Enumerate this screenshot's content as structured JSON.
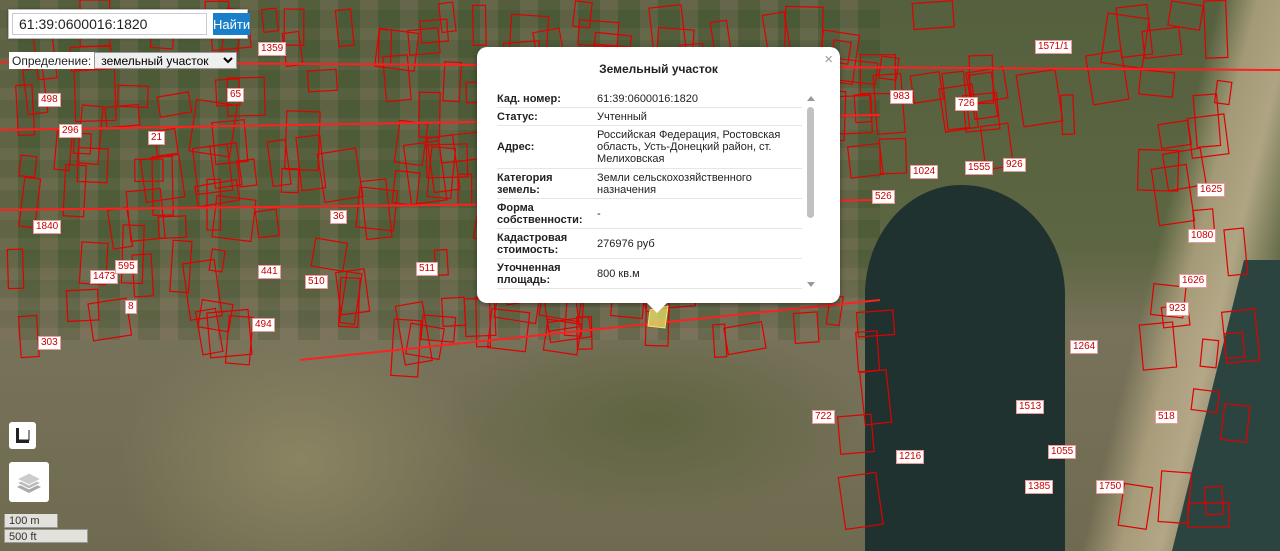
{
  "search": {
    "value": "61:39:0600016:1820",
    "button_label": "Найти"
  },
  "definition": {
    "label": "Определение:",
    "selected": "земельный участок"
  },
  "popup": {
    "title": "Земельный участок",
    "close_icon": "×",
    "rows": [
      {
        "key": "Кад. номер:",
        "value": "61:39:0600016:1820"
      },
      {
        "key": "Статус:",
        "value": "Учтенный"
      },
      {
        "key": "Адрес:",
        "value": "Российская Федерация, Ростовская область, Усть-Донецкий район, ст. Мелиховская"
      },
      {
        "key": "Категория земель:",
        "value": "Земли сельскохозяйственного назначения"
      },
      {
        "key": "Форма собственности:",
        "value": "-"
      },
      {
        "key": "Кадастровая стоимость:",
        "value": "276976 руб"
      },
      {
        "key": "Уточненная площадь:",
        "value": "800 кв.м"
      }
    ]
  },
  "controls": {
    "ruler_icon": "ruler-icon",
    "layers_icon": "layers-icon"
  },
  "scale": {
    "metric": "100 m",
    "imperial": "500 ft"
  },
  "map_labels": [
    "498",
    "296",
    "21",
    "1359",
    "65",
    "1571/1",
    "983",
    "726",
    "1024",
    "1555",
    "926",
    "1625",
    "1080",
    "1626",
    "923",
    "526",
    "1264",
    "1513",
    "722",
    "1055",
    "1216",
    "1385",
    "1750",
    "518",
    "494",
    "303",
    "511",
    "510",
    "441",
    "1840",
    "1473",
    "595",
    "8",
    "36"
  ],
  "colors": {
    "parcel_line": "#e00000",
    "button": "#1a7fc8",
    "highlight": "#f3e96b"
  }
}
